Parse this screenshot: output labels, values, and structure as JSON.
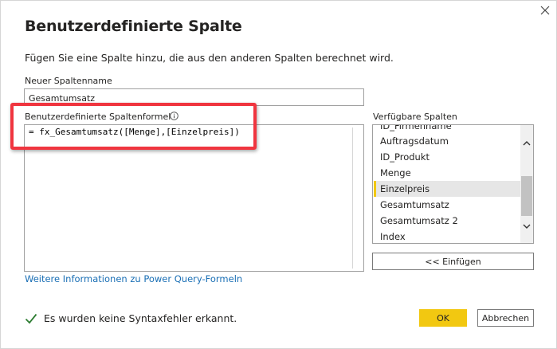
{
  "dialog": {
    "title": "Benutzerdefinierte Spalte",
    "description": "Fügen Sie eine Spalte hinzu, die aus den anderen Spalten berechnet wird.",
    "close_icon": "close-icon"
  },
  "column_name": {
    "label": "Neuer Spaltenname",
    "value": "Gesamtumsatz"
  },
  "formula": {
    "label": "Benutzerdefinierte Spaltenformel",
    "info_icon": "info-icon",
    "value": "= fx_Gesamtumsatz([Menge],[Einzelpreis])",
    "highlight_color": "#f0353f"
  },
  "available_columns": {
    "label": "Verfügbare Spalten",
    "items": [
      {
        "label": "ID_Firmenname",
        "selected": false
      },
      {
        "label": "Auftragsdatum",
        "selected": false
      },
      {
        "label": "ID_Produkt",
        "selected": false
      },
      {
        "label": "Menge",
        "selected": false
      },
      {
        "label": "Einzelpreis",
        "selected": true
      },
      {
        "label": "Gesamtumsatz",
        "selected": false
      },
      {
        "label": "Gesamtumsatz 2",
        "selected": false
      },
      {
        "label": "Index",
        "selected": false
      }
    ],
    "insert_label": "<< Einfügen",
    "accent_color": "#f2c811"
  },
  "more_info_link": "Weitere Informationen zu Power Query-Formeln",
  "status": {
    "icon": "check-icon",
    "text": "Es wurden keine Syntaxfehler erkannt.",
    "color": "#2e7d32"
  },
  "buttons": {
    "ok_label": "OK",
    "cancel_label": "Abbrechen",
    "ok_color": "#f2c811"
  }
}
